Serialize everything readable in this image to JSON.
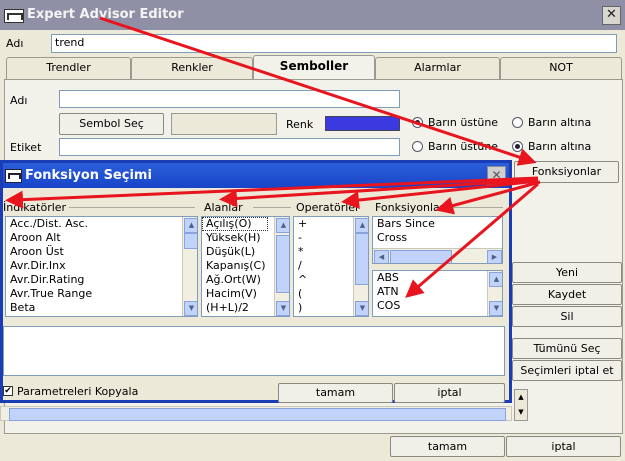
{
  "window": {
    "title": "Expert Advisor Editor",
    "close": "✕"
  },
  "name_label": "Adı",
  "name_value": "trend",
  "tabs": [
    "Trendler",
    "Renkler",
    "Semboller",
    "Alarmlar",
    "NOT"
  ],
  "semboller": {
    "name_label": "Adı",
    "symbol_button": "Sembol Seç",
    "color_label": "Renk",
    "color_value": "#3a3ae0",
    "label_label": "Etiket",
    "radios_row1": [
      "Barın üstüne",
      "Barın altına"
    ],
    "radios_row2": [
      "Barın üstüne",
      "Barın altına"
    ],
    "functions_button": "Fonksiyonlar"
  },
  "side_buttons": [
    "Yeni",
    "Kaydet",
    "Sil",
    "Tümünü Seç",
    "Seçimleri iptal et"
  ],
  "bottom_buttons": {
    "ok": "tamam",
    "cancel": "iptal"
  },
  "dialog": {
    "title": "Fonksiyon Seçimi",
    "close": "✕",
    "columns": {
      "indicators": {
        "label": "İndikatörler",
        "items": [
          "Acc./Dist. Asc.",
          "Aroon Alt",
          "Aroon Üst",
          "Avr.Dir.Inx",
          "Avr.Dir.Rating",
          "Avr.True Range",
          "Beta"
        ]
      },
      "fields": {
        "label": "Alanlar",
        "items": [
          "Açılış(O)",
          "Yüksek(H)",
          "Düşük(L)",
          "Kapanış(C)",
          "Ağ.Ort(W)",
          "Hacim(V)",
          "(H+L)/2"
        ]
      },
      "operators": {
        "label": "Operatörler",
        "items": [
          "+",
          "-",
          "*",
          "/",
          "^",
          "(",
          ")"
        ]
      },
      "functions": {
        "label": "Fonksiyonlar",
        "items_top": [
          "Bars Since",
          "Cross"
        ],
        "items_bottom": [
          "ABS",
          "ATN",
          "COS"
        ]
      }
    },
    "checkbox_label": "Parametreleri Kopyala",
    "ok": "tamam",
    "cancel": "iptal"
  },
  "accent_colors": {
    "arrows": "#e8141e",
    "dialog_title": "#1844c9"
  }
}
